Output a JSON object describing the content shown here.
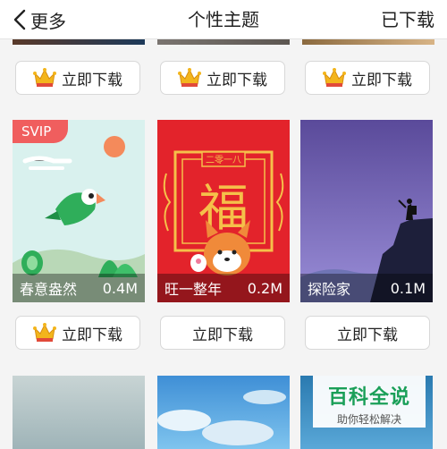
{
  "nav": {
    "back_label": "更多",
    "title": "个性主题",
    "right_label": "已下载"
  },
  "row1_buttons": [
    {
      "label": "立即下载",
      "icon": "crown-icon"
    },
    {
      "label": "立即下载",
      "icon": "crown-icon"
    },
    {
      "label": "立即下载",
      "icon": "crown-icon"
    }
  ],
  "themes": [
    {
      "name": "春意盎然",
      "size": "0.4M",
      "badge": "SVIP"
    },
    {
      "name": "旺一整年",
      "size": "0.2M",
      "banner": "二零一八",
      "center_char": "福"
    },
    {
      "name": "探险家",
      "size": "0.1M"
    }
  ],
  "row2_buttons": [
    {
      "label": "立即下载",
      "icon": "crown-icon"
    },
    {
      "label": "立即下载"
    },
    {
      "label": "立即下载"
    }
  ],
  "watermark": {
    "title": "百科全说",
    "subtitle": "助你轻松解决"
  },
  "colors": {
    "svip_badge": "#f05e5e",
    "watermark_green": "#1a9f58",
    "crown": "#f3b51c"
  }
}
